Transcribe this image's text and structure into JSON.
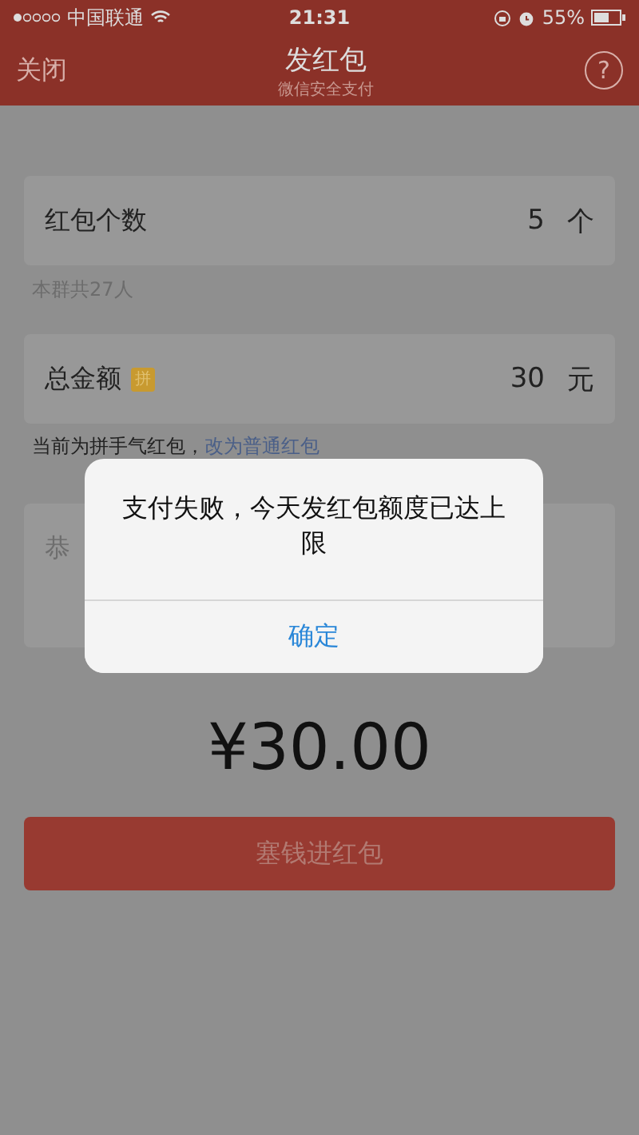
{
  "status_bar": {
    "carrier": "中国联通",
    "time": "21:31",
    "battery": "55%"
  },
  "nav": {
    "left": "关闭",
    "title": "发红包",
    "subtitle": "微信安全支付",
    "help": "?"
  },
  "form": {
    "count": {
      "label": "红包个数",
      "value": "5",
      "unit": "个"
    },
    "count_note": "本群共27人",
    "total": {
      "label": "总金额",
      "badge": "拼",
      "value": "30",
      "unit": "元"
    },
    "type_note": "当前为拼手气红包，",
    "type_link": "改为普通红包",
    "greeting": {
      "placeholder": "恭"
    },
    "amount": "¥30.00",
    "submit": "塞钱进红包"
  },
  "alert": {
    "message": "支付失败，今天发红包额度已达上限",
    "button": "确定"
  }
}
